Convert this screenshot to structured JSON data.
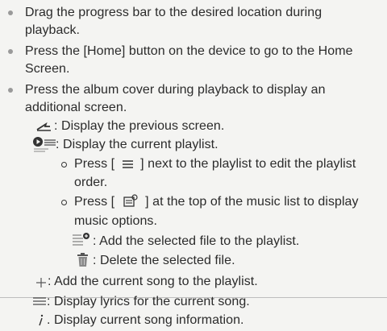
{
  "bullets": {
    "drag": [
      "Drag the progress bar to the desired location during",
      "playback."
    ],
    "home": [
      "Press the [Home] button on the device to go to the Home",
      "Screen."
    ],
    "album": [
      "Press the album cover during playback to display an",
      "additional screen."
    ]
  },
  "icons": {
    "back": {
      "icon": "back-arrow-icon",
      "text": ": Display the previous screen."
    },
    "playlist": {
      "icon": "playlist-icon",
      "text": ": Display the current playlist."
    },
    "add_file": {
      "icon": "add-to-playlist-icon",
      "text": ": Add the selected file to the playlist."
    },
    "delete": {
      "icon": "trash-icon",
      "text": ": Delete the selected file."
    },
    "add_song": {
      "icon": "add-icon",
      "text": ": Add the current song to the playlist."
    },
    "lyrics": {
      "icon": "lyrics-icon",
      "text": ": Display lyrics for the current song."
    },
    "info": {
      "icon": "info-icon",
      "text": ". Display current song information."
    }
  },
  "sub": {
    "edit_order": {
      "before": "Press [",
      "icon": "menu-icon",
      "after": "] next to the playlist to edit the playlist",
      "line2": "order."
    },
    "music_options": {
      "before": "Press [",
      "icon": "music-options-icon",
      "after": "] at the top of the music list to display",
      "line2": "music options."
    }
  },
  "colors": {
    "text": "#2b2b2b",
    "bullet": "#9a9a9a",
    "background": "#f4f4f2"
  }
}
